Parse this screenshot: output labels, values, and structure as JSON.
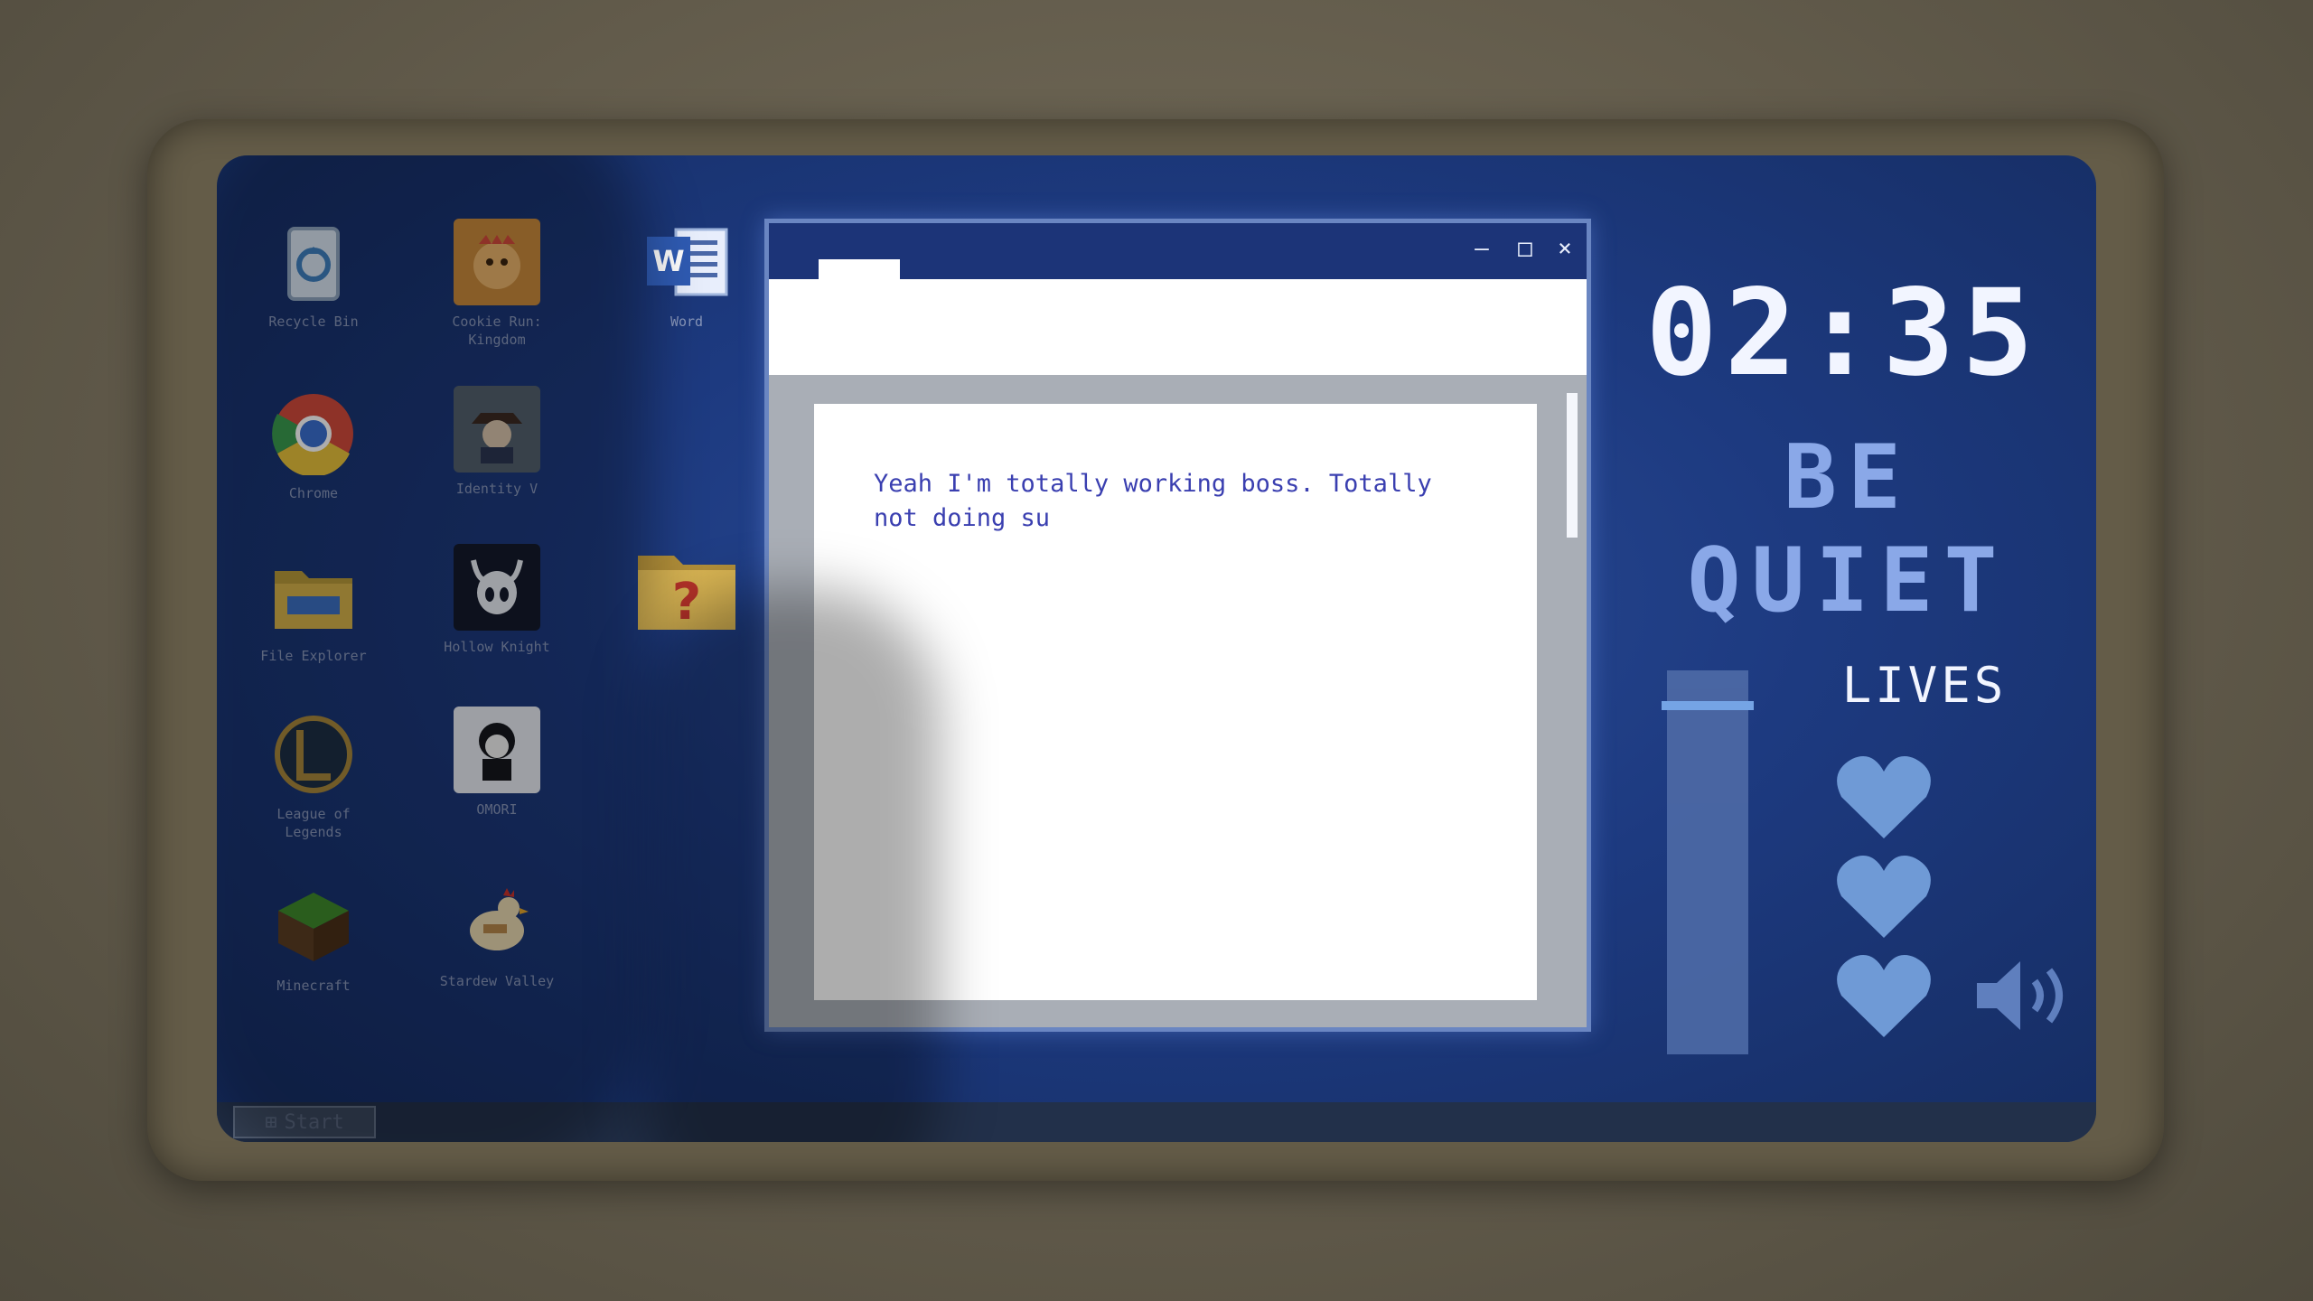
{
  "desktop": {
    "icons": [
      {
        "label": "Recycle Bin",
        "icon": "recycle-bin-icon"
      },
      {
        "label": "Chrome",
        "icon": "chrome-icon"
      },
      {
        "label": "File Explorer",
        "icon": "folder-icon"
      },
      {
        "label": "League of\nLegends",
        "icon": "league-icon"
      },
      {
        "label": "Minecraft",
        "icon": "minecraft-icon"
      },
      {
        "label": "Cookie Run:\nKingdom",
        "icon": "cookie-run-icon"
      },
      {
        "label": "Identity V",
        "icon": "identity-v-icon"
      },
      {
        "label": "Hollow Knight",
        "icon": "hollow-knight-icon"
      },
      {
        "label": "OMORI",
        "icon": "omori-icon"
      },
      {
        "label": "Stardew Valley",
        "icon": "stardew-icon"
      },
      {
        "label": "Word",
        "icon": "word-icon"
      },
      {
        "label": "",
        "icon": "mystery-folder-icon"
      }
    ]
  },
  "window": {
    "minimize": "—",
    "maximize": "□",
    "close": "×",
    "document_text": "Yeah I'm totally working boss. Totally not doing su"
  },
  "hud": {
    "clock": "02:35",
    "warning": "BE QUIET",
    "lives_label": "LIVES",
    "lives": 3,
    "noise_level": 0.5
  },
  "taskbar": {
    "start_label": "Start"
  }
}
